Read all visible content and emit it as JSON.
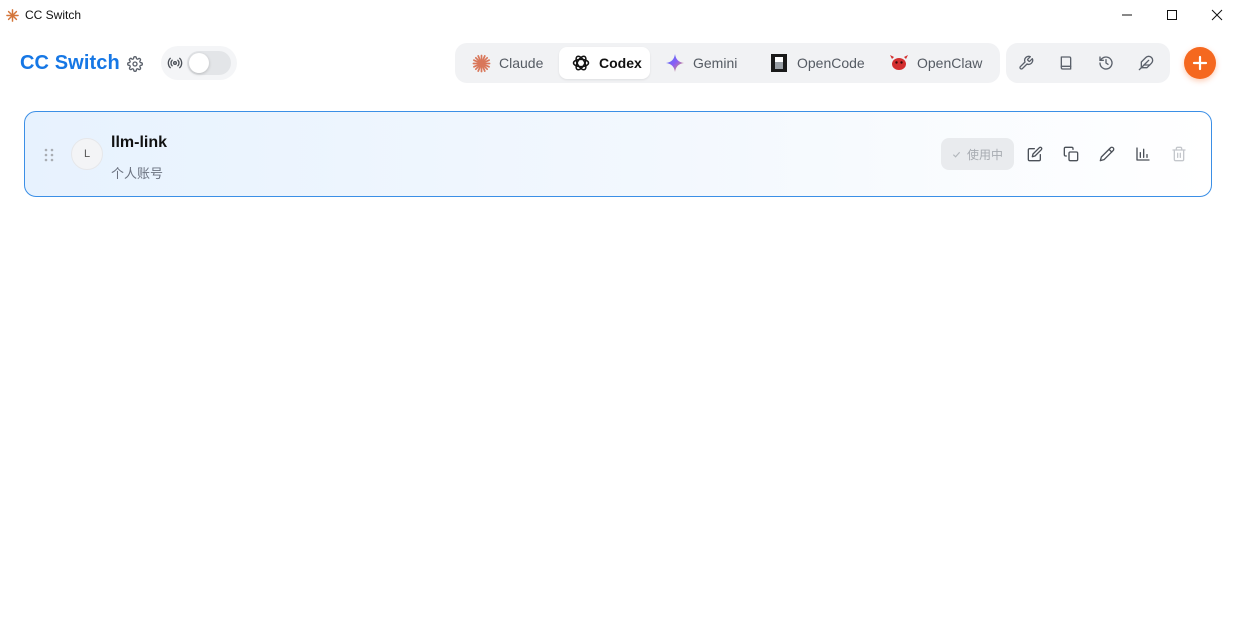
{
  "window": {
    "title": "CC Switch",
    "controls": [
      "minimize-icon",
      "maximize-icon",
      "close-icon"
    ]
  },
  "header": {
    "brand": "CC Switch",
    "settings_icon": "gear-icon",
    "proxy": {
      "icon": "radio-broadcast-icon",
      "enabled": false
    }
  },
  "apps": [
    {
      "label": "Claude",
      "icon": "claude-icon",
      "active": false
    },
    {
      "label": "Codex",
      "icon": "openai-icon",
      "active": true
    },
    {
      "label": "Gemini",
      "icon": "gemini-icon",
      "active": false
    },
    {
      "label": "OpenCode",
      "icon": "opencode-icon",
      "active": false
    },
    {
      "label": "OpenClaw",
      "icon": "openclaw-icon",
      "active": false
    }
  ],
  "tools": [
    "wrench-icon",
    "book-icon",
    "history-icon",
    "feather-icon"
  ],
  "add_button": {
    "icon": "plus-icon"
  },
  "providers": [
    {
      "avatar": "L",
      "name": "llm-link",
      "note": "个人账号",
      "status": "使用中",
      "actions": [
        "edit-icon",
        "copy-icon",
        "pencil-icon",
        "chart-icon",
        "trash-icon"
      ]
    }
  ],
  "colors": {
    "brand": "#1677e5",
    "accent": "#f5681f",
    "card_border": "#3b8fe6"
  }
}
